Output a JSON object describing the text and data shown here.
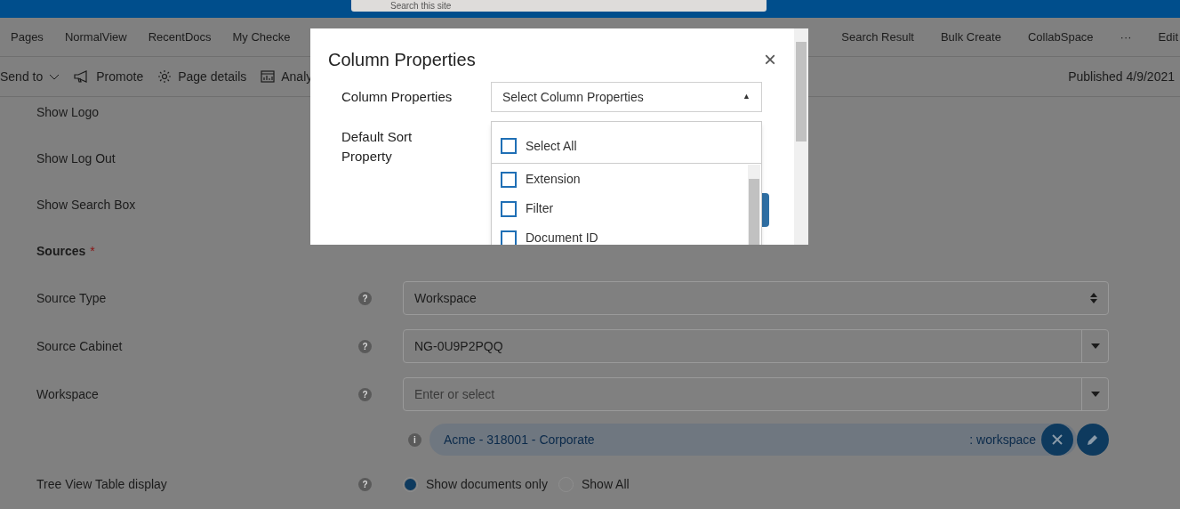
{
  "search": {
    "placeholder": "Search this site"
  },
  "nav": {
    "left": [
      {
        "label": "Pages"
      },
      {
        "label": "NormalView"
      },
      {
        "label": "RecentDocs"
      },
      {
        "label": "My Checke"
      }
    ],
    "right": [
      {
        "label": "Search Result"
      },
      {
        "label": "Bulk Create"
      },
      {
        "label": "CollabSpace"
      },
      {
        "label": "···"
      },
      {
        "label": "Edit"
      }
    ]
  },
  "toolbar": {
    "items": [
      {
        "kind": "sendto",
        "label": "Send to"
      },
      {
        "kind": "promote",
        "label": "Promote"
      },
      {
        "kind": "details",
        "label": "Page details"
      },
      {
        "kind": "analytics",
        "label": "Analy"
      }
    ],
    "status": "Published 4/9/2021"
  },
  "form": [
    {
      "kind": "label",
      "label": "Show Logo"
    },
    {
      "kind": "label",
      "label": "Show Log Out"
    },
    {
      "kind": "label",
      "label": "Show Search Box"
    },
    {
      "kind": "section",
      "label": "Sources",
      "required": "*"
    },
    {
      "kind": "select",
      "label": "Source Type",
      "help": "?",
      "value": "Workspace"
    },
    {
      "kind": "combo",
      "label": "Source Cabinet",
      "help": "?",
      "value": "NG-0U9P2PQQ"
    },
    {
      "kind": "combo",
      "label": "Workspace",
      "help": "?",
      "placeholder": "Enter or select"
    },
    {
      "kind": "chip",
      "info": "i",
      "name": "Acme - 318001 - Corporate",
      "type": ": workspace"
    },
    {
      "kind": "radio",
      "label": "Tree View Table display",
      "help": "?",
      "options": [
        {
          "label": "Show documents only",
          "selected": true
        },
        {
          "label": "Show All",
          "selected": false
        }
      ]
    }
  ],
  "modal": {
    "title": "Column Properties",
    "close": "×",
    "fields": [
      {
        "label": "Column Properties",
        "placeholder": "Select Column Properties",
        "caret": "▲"
      },
      {
        "label": "Default Sort Property"
      }
    ],
    "dropdown": {
      "select_all": {
        "label": "Select All",
        "checked": false
      },
      "options": [
        {
          "label": "Extension",
          "checked": false
        },
        {
          "label": "Filter",
          "checked": false
        },
        {
          "label": "Document ID",
          "checked": false
        }
      ]
    }
  }
}
